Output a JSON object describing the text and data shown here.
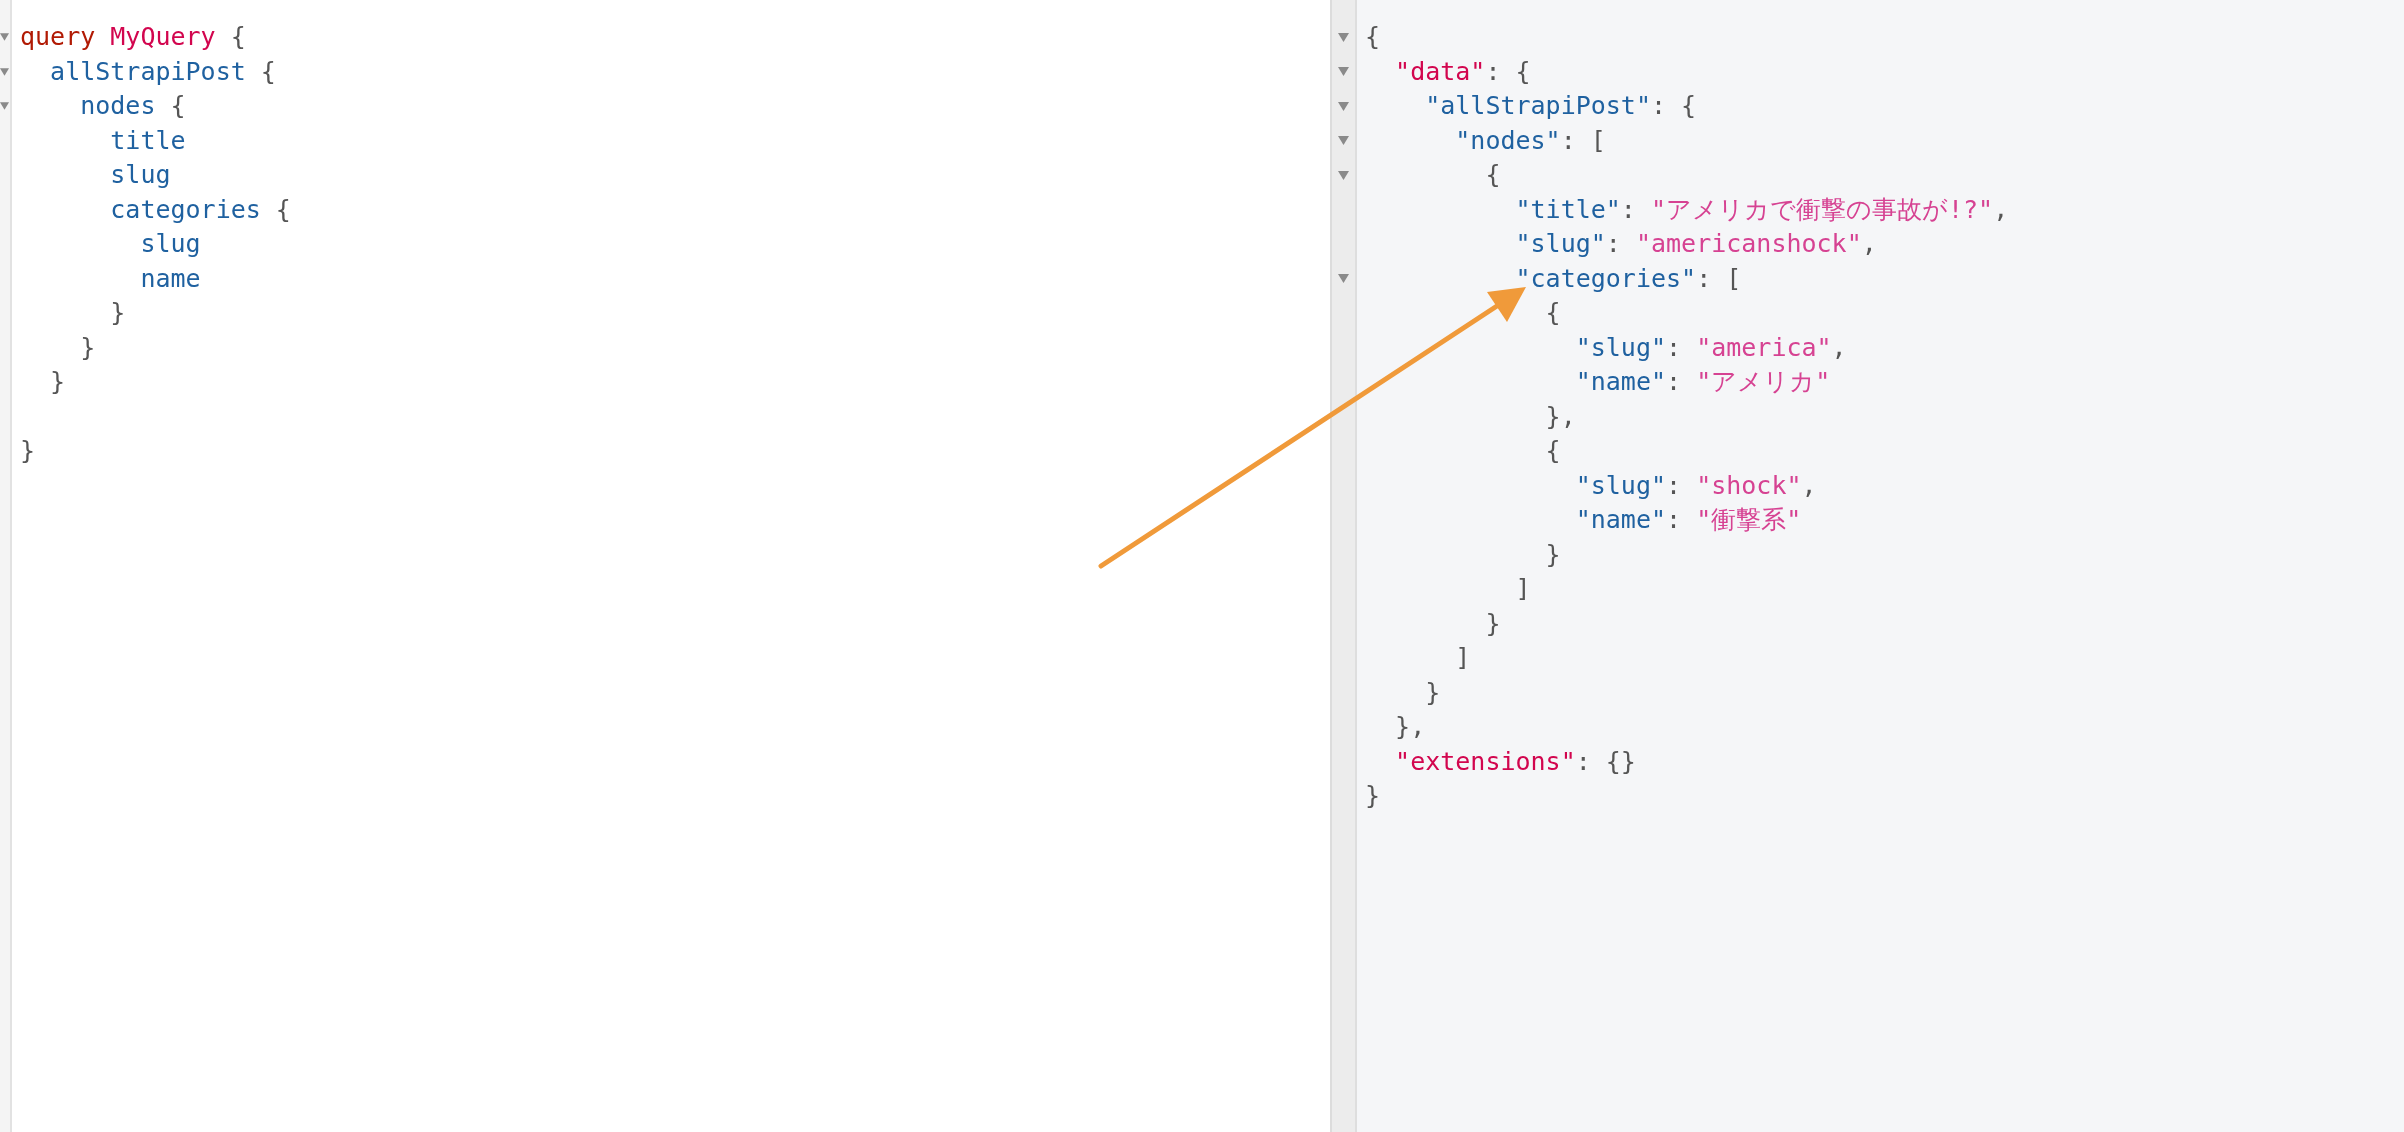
{
  "query_editor": {
    "lines": [
      {
        "fold": true,
        "tokens": [
          {
            "kind": "keyword",
            "text": "query "
          },
          {
            "kind": "def",
            "text": "MyQuery"
          },
          {
            "kind": "punct",
            "text": " {"
          }
        ],
        "children": [
          {
            "fold": true,
            "tokens": [
              {
                "kind": "field",
                "text": "allStrapiPost"
              },
              {
                "kind": "punct",
                "text": " {"
              }
            ],
            "children": [
              {
                "fold": true,
                "tokens": [
                  {
                    "kind": "field",
                    "text": "nodes"
                  },
                  {
                    "kind": "punct",
                    "text": " {"
                  }
                ],
                "children": [
                  {
                    "fold": false,
                    "tokens": [
                      {
                        "kind": "field",
                        "text": "title"
                      }
                    ]
                  },
                  {
                    "fold": false,
                    "tokens": [
                      {
                        "kind": "field",
                        "text": "slug"
                      }
                    ]
                  },
                  {
                    "fold": false,
                    "tokens": [
                      {
                        "kind": "field",
                        "text": "categories"
                      },
                      {
                        "kind": "punct",
                        "text": " {"
                      }
                    ],
                    "children": [
                      {
                        "fold": false,
                        "tokens": [
                          {
                            "kind": "field",
                            "text": "slug"
                          }
                        ]
                      },
                      {
                        "fold": false,
                        "tokens": [
                          {
                            "kind": "field",
                            "text": "name"
                          }
                        ]
                      }
                    ]
                  },
                  {
                    "fold": false,
                    "tokens": [
                      {
                        "kind": "punct",
                        "text": "}"
                      }
                    ]
                  }
                ]
              },
              {
                "fold": false,
                "tokens": [
                  {
                    "kind": "punct",
                    "text": "}"
                  }
                ]
              }
            ]
          },
          {
            "fold": false,
            "tokens": [
              {
                "kind": "punct",
                "text": "}"
              }
            ]
          }
        ]
      },
      {
        "fold": false,
        "blank_line_before": true,
        "tokens": [
          {
            "kind": "punct",
            "text": "}"
          }
        ]
      }
    ]
  },
  "result_viewer": {
    "lines": [
      {
        "fold": true,
        "tokens": [
          {
            "kind": "punct",
            "text": "{"
          }
        ],
        "children": [
          {
            "fold": true,
            "tokens": [
              {
                "kind": "rootkey",
                "text": "\"data\""
              },
              {
                "kind": "punct",
                "text": ": {"
              }
            ],
            "children": [
              {
                "fold": true,
                "tokens": [
                  {
                    "kind": "field",
                    "text": "\"allStrapiPost\""
                  },
                  {
                    "kind": "punct",
                    "text": ": {"
                  }
                ],
                "children": [
                  {
                    "fold": true,
                    "tokens": [
                      {
                        "kind": "field",
                        "text": "\"nodes\""
                      },
                      {
                        "kind": "punct",
                        "text": ": ["
                      }
                    ],
                    "children": [
                      {
                        "fold": true,
                        "tokens": [
                          {
                            "kind": "punct",
                            "text": "{"
                          }
                        ],
                        "children": [
                          {
                            "fold": false,
                            "tokens": [
                              {
                                "kind": "field",
                                "text": "\"title\""
                              },
                              {
                                "kind": "punct",
                                "text": ": "
                              },
                              {
                                "kind": "string",
                                "text": "\"アメリカで衝撃の事故が!?\""
                              },
                              {
                                "kind": "punct",
                                "text": ","
                              }
                            ]
                          },
                          {
                            "fold": false,
                            "tokens": [
                              {
                                "kind": "field",
                                "text": "\"slug\""
                              },
                              {
                                "kind": "punct",
                                "text": ": "
                              },
                              {
                                "kind": "string",
                                "text": "\"americanshock\""
                              },
                              {
                                "kind": "punct",
                                "text": ","
                              }
                            ]
                          },
                          {
                            "fold": true,
                            "tokens": [
                              {
                                "kind": "field",
                                "text": "\"categories\""
                              },
                              {
                                "kind": "punct",
                                "text": ": ["
                              }
                            ],
                            "children": [
                              {
                                "fold": false,
                                "tokens": [
                                  {
                                    "kind": "punct",
                                    "text": "{"
                                  }
                                ],
                                "children": [
                                  {
                                    "fold": false,
                                    "tokens": [
                                      {
                                        "kind": "field",
                                        "text": "\"slug\""
                                      },
                                      {
                                        "kind": "punct",
                                        "text": ": "
                                      },
                                      {
                                        "kind": "string",
                                        "text": "\"america\""
                                      },
                                      {
                                        "kind": "punct",
                                        "text": ","
                                      }
                                    ]
                                  },
                                  {
                                    "fold": false,
                                    "tokens": [
                                      {
                                        "kind": "field",
                                        "text": "\"name\""
                                      },
                                      {
                                        "kind": "punct",
                                        "text": ": "
                                      },
                                      {
                                        "kind": "string",
                                        "text": "\"アメリカ\""
                                      }
                                    ]
                                  }
                                ]
                              },
                              {
                                "fold": false,
                                "tokens": [
                                  {
                                    "kind": "punct",
                                    "text": "},"
                                  }
                                ]
                              },
                              {
                                "fold": false,
                                "tokens": [
                                  {
                                    "kind": "punct",
                                    "text": "{"
                                  }
                                ],
                                "children": [
                                  {
                                    "fold": false,
                                    "tokens": [
                                      {
                                        "kind": "field",
                                        "text": "\"slug\""
                                      },
                                      {
                                        "kind": "punct",
                                        "text": ": "
                                      },
                                      {
                                        "kind": "string",
                                        "text": "\"shock\""
                                      },
                                      {
                                        "kind": "punct",
                                        "text": ","
                                      }
                                    ]
                                  },
                                  {
                                    "fold": false,
                                    "tokens": [
                                      {
                                        "kind": "field",
                                        "text": "\"name\""
                                      },
                                      {
                                        "kind": "punct",
                                        "text": ": "
                                      },
                                      {
                                        "kind": "string",
                                        "text": "\"衝撃系\""
                                      }
                                    ]
                                  }
                                ]
                              },
                              {
                                "fold": false,
                                "tokens": [
                                  {
                                    "kind": "punct",
                                    "text": "}"
                                  }
                                ]
                              }
                            ]
                          },
                          {
                            "fold": false,
                            "tokens": [
                              {
                                "kind": "punct",
                                "text": "]"
                              }
                            ]
                          }
                        ]
                      },
                      {
                        "fold": false,
                        "tokens": [
                          {
                            "kind": "punct",
                            "text": "}"
                          }
                        ]
                      }
                    ]
                  },
                  {
                    "fold": false,
                    "tokens": [
                      {
                        "kind": "punct",
                        "text": "]"
                      }
                    ]
                  }
                ]
              },
              {
                "fold": false,
                "tokens": [
                  {
                    "kind": "punct",
                    "text": "}"
                  }
                ]
              }
            ]
          },
          {
            "fold": false,
            "tokens": [
              {
                "kind": "punct",
                "text": "},"
              }
            ]
          },
          {
            "fold": false,
            "tokens": [
              {
                "kind": "rootkey",
                "text": "\"extensions\""
              },
              {
                "kind": "punct",
                "text": ": {}"
              }
            ]
          }
        ]
      },
      {
        "fold": false,
        "tokens": [
          {
            "kind": "punct",
            "text": "}"
          }
        ]
      }
    ]
  }
}
